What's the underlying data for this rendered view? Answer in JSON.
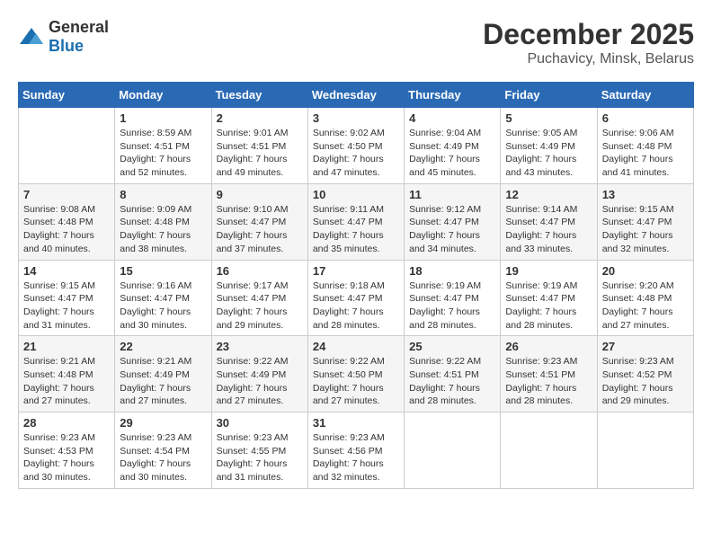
{
  "header": {
    "logo": {
      "general": "General",
      "blue": "Blue"
    },
    "title": "December 2025",
    "location": "Puchavicy, Minsk, Belarus"
  },
  "calendar": {
    "days_of_week": [
      "Sunday",
      "Monday",
      "Tuesday",
      "Wednesday",
      "Thursday",
      "Friday",
      "Saturday"
    ],
    "weeks": [
      [
        {
          "day": "",
          "sunrise": "",
          "sunset": "",
          "daylight": ""
        },
        {
          "day": "1",
          "sunrise": "Sunrise: 8:59 AM",
          "sunset": "Sunset: 4:51 PM",
          "daylight": "Daylight: 7 hours and 52 minutes."
        },
        {
          "day": "2",
          "sunrise": "Sunrise: 9:01 AM",
          "sunset": "Sunset: 4:51 PM",
          "daylight": "Daylight: 7 hours and 49 minutes."
        },
        {
          "day": "3",
          "sunrise": "Sunrise: 9:02 AM",
          "sunset": "Sunset: 4:50 PM",
          "daylight": "Daylight: 7 hours and 47 minutes."
        },
        {
          "day": "4",
          "sunrise": "Sunrise: 9:04 AM",
          "sunset": "Sunset: 4:49 PM",
          "daylight": "Daylight: 7 hours and 45 minutes."
        },
        {
          "day": "5",
          "sunrise": "Sunrise: 9:05 AM",
          "sunset": "Sunset: 4:49 PM",
          "daylight": "Daylight: 7 hours and 43 minutes."
        },
        {
          "day": "6",
          "sunrise": "Sunrise: 9:06 AM",
          "sunset": "Sunset: 4:48 PM",
          "daylight": "Daylight: 7 hours and 41 minutes."
        }
      ],
      [
        {
          "day": "7",
          "sunrise": "Sunrise: 9:08 AM",
          "sunset": "Sunset: 4:48 PM",
          "daylight": "Daylight: 7 hours and 40 minutes."
        },
        {
          "day": "8",
          "sunrise": "Sunrise: 9:09 AM",
          "sunset": "Sunset: 4:48 PM",
          "daylight": "Daylight: 7 hours and 38 minutes."
        },
        {
          "day": "9",
          "sunrise": "Sunrise: 9:10 AM",
          "sunset": "Sunset: 4:47 PM",
          "daylight": "Daylight: 7 hours and 37 minutes."
        },
        {
          "day": "10",
          "sunrise": "Sunrise: 9:11 AM",
          "sunset": "Sunset: 4:47 PM",
          "daylight": "Daylight: 7 hours and 35 minutes."
        },
        {
          "day": "11",
          "sunrise": "Sunrise: 9:12 AM",
          "sunset": "Sunset: 4:47 PM",
          "daylight": "Daylight: 7 hours and 34 minutes."
        },
        {
          "day": "12",
          "sunrise": "Sunrise: 9:14 AM",
          "sunset": "Sunset: 4:47 PM",
          "daylight": "Daylight: 7 hours and 33 minutes."
        },
        {
          "day": "13",
          "sunrise": "Sunrise: 9:15 AM",
          "sunset": "Sunset: 4:47 PM",
          "daylight": "Daylight: 7 hours and 32 minutes."
        }
      ],
      [
        {
          "day": "14",
          "sunrise": "Sunrise: 9:15 AM",
          "sunset": "Sunset: 4:47 PM",
          "daylight": "Daylight: 7 hours and 31 minutes."
        },
        {
          "day": "15",
          "sunrise": "Sunrise: 9:16 AM",
          "sunset": "Sunset: 4:47 PM",
          "daylight": "Daylight: 7 hours and 30 minutes."
        },
        {
          "day": "16",
          "sunrise": "Sunrise: 9:17 AM",
          "sunset": "Sunset: 4:47 PM",
          "daylight": "Daylight: 7 hours and 29 minutes."
        },
        {
          "day": "17",
          "sunrise": "Sunrise: 9:18 AM",
          "sunset": "Sunset: 4:47 PM",
          "daylight": "Daylight: 7 hours and 28 minutes."
        },
        {
          "day": "18",
          "sunrise": "Sunrise: 9:19 AM",
          "sunset": "Sunset: 4:47 PM",
          "daylight": "Daylight: 7 hours and 28 minutes."
        },
        {
          "day": "19",
          "sunrise": "Sunrise: 9:19 AM",
          "sunset": "Sunset: 4:47 PM",
          "daylight": "Daylight: 7 hours and 28 minutes."
        },
        {
          "day": "20",
          "sunrise": "Sunrise: 9:20 AM",
          "sunset": "Sunset: 4:48 PM",
          "daylight": "Daylight: 7 hours and 27 minutes."
        }
      ],
      [
        {
          "day": "21",
          "sunrise": "Sunrise: 9:21 AM",
          "sunset": "Sunset: 4:48 PM",
          "daylight": "Daylight: 7 hours and 27 minutes."
        },
        {
          "day": "22",
          "sunrise": "Sunrise: 9:21 AM",
          "sunset": "Sunset: 4:49 PM",
          "daylight": "Daylight: 7 hours and 27 minutes."
        },
        {
          "day": "23",
          "sunrise": "Sunrise: 9:22 AM",
          "sunset": "Sunset: 4:49 PM",
          "daylight": "Daylight: 7 hours and 27 minutes."
        },
        {
          "day": "24",
          "sunrise": "Sunrise: 9:22 AM",
          "sunset": "Sunset: 4:50 PM",
          "daylight": "Daylight: 7 hours and 27 minutes."
        },
        {
          "day": "25",
          "sunrise": "Sunrise: 9:22 AM",
          "sunset": "Sunset: 4:51 PM",
          "daylight": "Daylight: 7 hours and 28 minutes."
        },
        {
          "day": "26",
          "sunrise": "Sunrise: 9:23 AM",
          "sunset": "Sunset: 4:51 PM",
          "daylight": "Daylight: 7 hours and 28 minutes."
        },
        {
          "day": "27",
          "sunrise": "Sunrise: 9:23 AM",
          "sunset": "Sunset: 4:52 PM",
          "daylight": "Daylight: 7 hours and 29 minutes."
        }
      ],
      [
        {
          "day": "28",
          "sunrise": "Sunrise: 9:23 AM",
          "sunset": "Sunset: 4:53 PM",
          "daylight": "Daylight: 7 hours and 30 minutes."
        },
        {
          "day": "29",
          "sunrise": "Sunrise: 9:23 AM",
          "sunset": "Sunset: 4:54 PM",
          "daylight": "Daylight: 7 hours and 30 minutes."
        },
        {
          "day": "30",
          "sunrise": "Sunrise: 9:23 AM",
          "sunset": "Sunset: 4:55 PM",
          "daylight": "Daylight: 7 hours and 31 minutes."
        },
        {
          "day": "31",
          "sunrise": "Sunrise: 9:23 AM",
          "sunset": "Sunset: 4:56 PM",
          "daylight": "Daylight: 7 hours and 32 minutes."
        },
        {
          "day": "",
          "sunrise": "",
          "sunset": "",
          "daylight": ""
        },
        {
          "day": "",
          "sunrise": "",
          "sunset": "",
          "daylight": ""
        },
        {
          "day": "",
          "sunrise": "",
          "sunset": "",
          "daylight": ""
        }
      ]
    ]
  }
}
